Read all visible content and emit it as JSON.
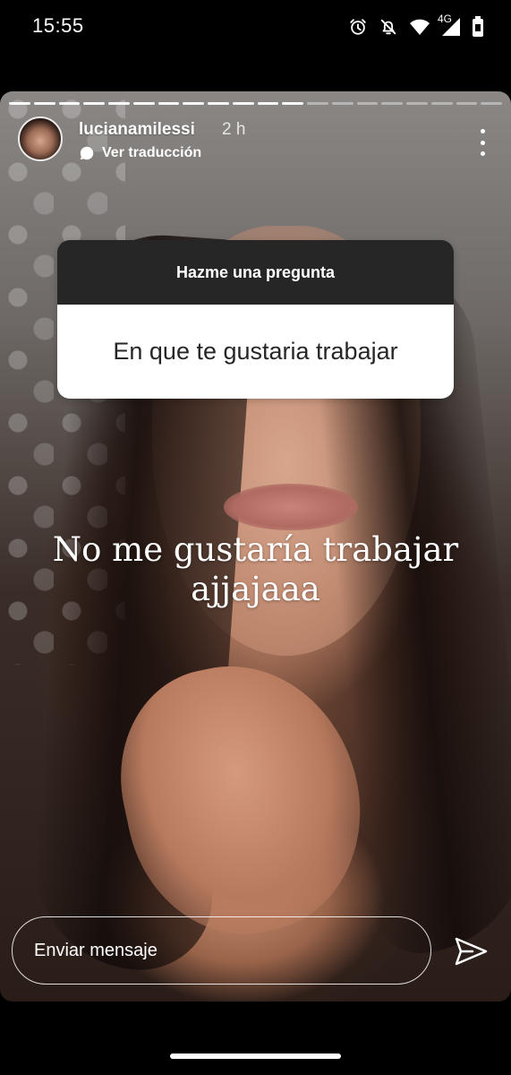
{
  "status_bar": {
    "time": "15:55",
    "network": "4G",
    "icons": [
      "alarm-icon",
      "notifications-off-icon",
      "wifi-icon",
      "signal-icon",
      "battery-icon"
    ]
  },
  "story": {
    "progress": {
      "total_segments": 20,
      "completed_segments": 12
    },
    "user": {
      "username": "lucianamilessi",
      "time_ago": "2 h",
      "translate_label": "Ver traducción"
    },
    "question_sticker": {
      "header": "Hazme una pregunta",
      "question": "En que te gustaria trabajar"
    },
    "answer_lines": [
      "No me gustaría trabajar",
      "ajjajaaa"
    ],
    "reply": {
      "placeholder": "Enviar mensaje"
    }
  }
}
